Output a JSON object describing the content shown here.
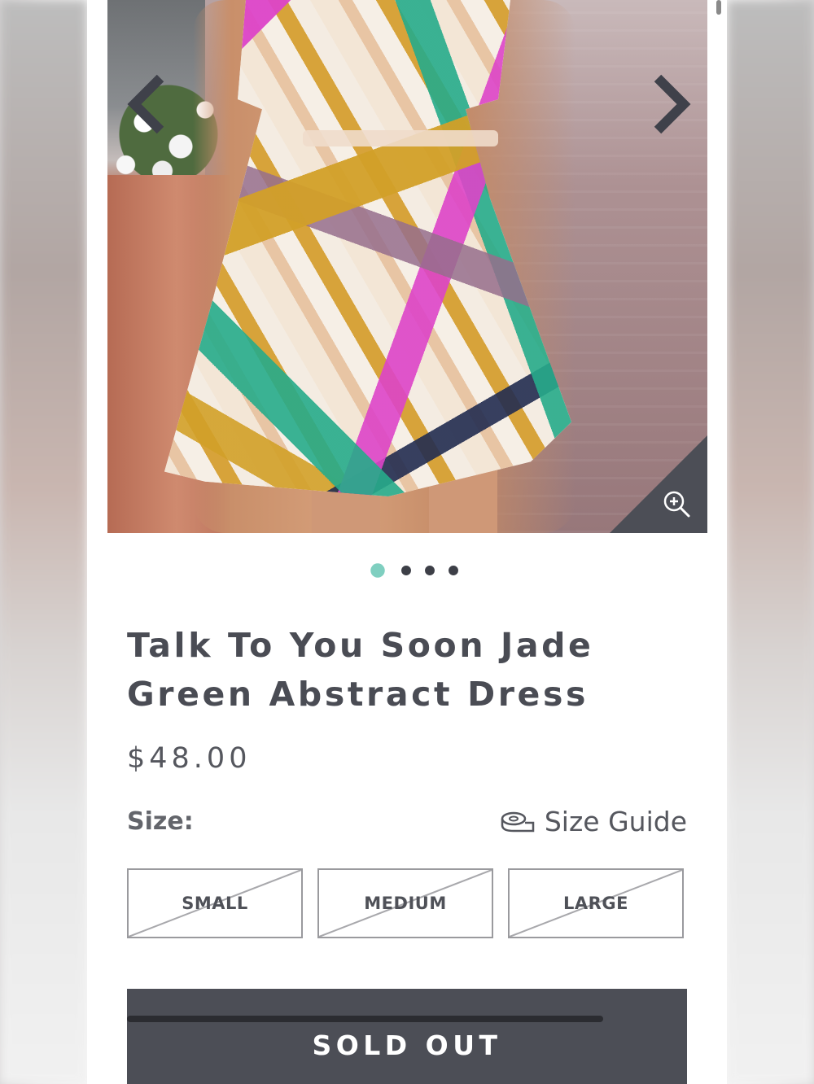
{
  "product": {
    "title": "Talk To You Soon Jade Green Abstract Dress",
    "price": "$48.00",
    "image_dots": {
      "count": 4,
      "active_index": 0
    }
  },
  "gallery": {
    "prev_icon": "chevron-left-icon",
    "next_icon": "chevron-right-icon",
    "zoom_icon": "zoom-in-icon"
  },
  "size": {
    "label": "Size:",
    "guide_label": "Size Guide",
    "guide_icon": "tape-measure-icon",
    "options": [
      {
        "label": "SMALL",
        "available": false
      },
      {
        "label": "MEDIUM",
        "available": false
      },
      {
        "label": "LARGE",
        "available": false
      }
    ]
  },
  "cta": {
    "label": "SOLD OUT"
  },
  "colors": {
    "text": "#4a4c54",
    "button_bg": "#4c4e56",
    "dot_active": "#7fcfc0",
    "dot_inactive": "#3d3f47"
  }
}
